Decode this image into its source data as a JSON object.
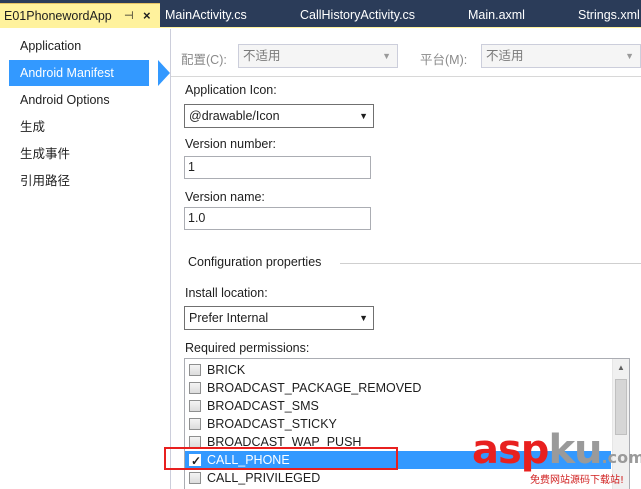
{
  "tabs": [
    {
      "label": "E01PhonewordApp",
      "active": true,
      "pin_icon": "pin-icon",
      "close_icon": "close-icon"
    },
    {
      "label": "MainActivity.cs"
    },
    {
      "label": "CallHistoryActivity.cs"
    },
    {
      "label": "Main.axml"
    },
    {
      "label": "Strings.xml"
    }
  ],
  "tab_glyphs": {
    "pin": "⊣",
    "close": "×"
  },
  "nav": {
    "items": [
      {
        "label": "Application"
      },
      {
        "label": "Android Manifest",
        "selected": true
      },
      {
        "label": "Android Options"
      },
      {
        "label": "生成"
      },
      {
        "label": "生成事件"
      },
      {
        "label": "引用路径"
      }
    ]
  },
  "config": {
    "configuration_label": "配置(C):",
    "configuration_value": "不适用",
    "platform_label": "平台(M):",
    "platform_value": "不适用"
  },
  "form": {
    "app_icon_label": "Application Icon:",
    "app_icon_value": "@drawable/Icon",
    "version_number_label": "Version number:",
    "version_number_value": "1",
    "version_name_label": "Version name:",
    "version_name_value": "1.0",
    "config_group_label": "Configuration properties",
    "install_location_label": "Install location:",
    "install_location_value": "Prefer Internal",
    "permissions_label": "Required permissions:"
  },
  "permissions": [
    {
      "name": "BRICK",
      "checked": false
    },
    {
      "name": "BROADCAST_PACKAGE_REMOVED",
      "checked": false
    },
    {
      "name": "BROADCAST_SMS",
      "checked": false
    },
    {
      "name": "BROADCAST_STICKY",
      "checked": false
    },
    {
      "name": "BROADCAST_WAP_PUSH",
      "checked": false
    },
    {
      "name": "CALL_PHONE",
      "checked": true
    },
    {
      "name": "CALL_PRIVILEGED",
      "checked": false
    }
  ],
  "glyphs": {
    "dropdown": "▼",
    "scroll_up": "▲",
    "check": "✓"
  },
  "watermark": {
    "red": "asp",
    "gray": "ku",
    "tld": ".com",
    "subtitle": "免费网站源码下载站!"
  },
  "colors": {
    "accent": "#3399ff",
    "tab_bar": "#2b3c59",
    "active_tab": "#fff29d",
    "highlight": "#e8201f"
  }
}
